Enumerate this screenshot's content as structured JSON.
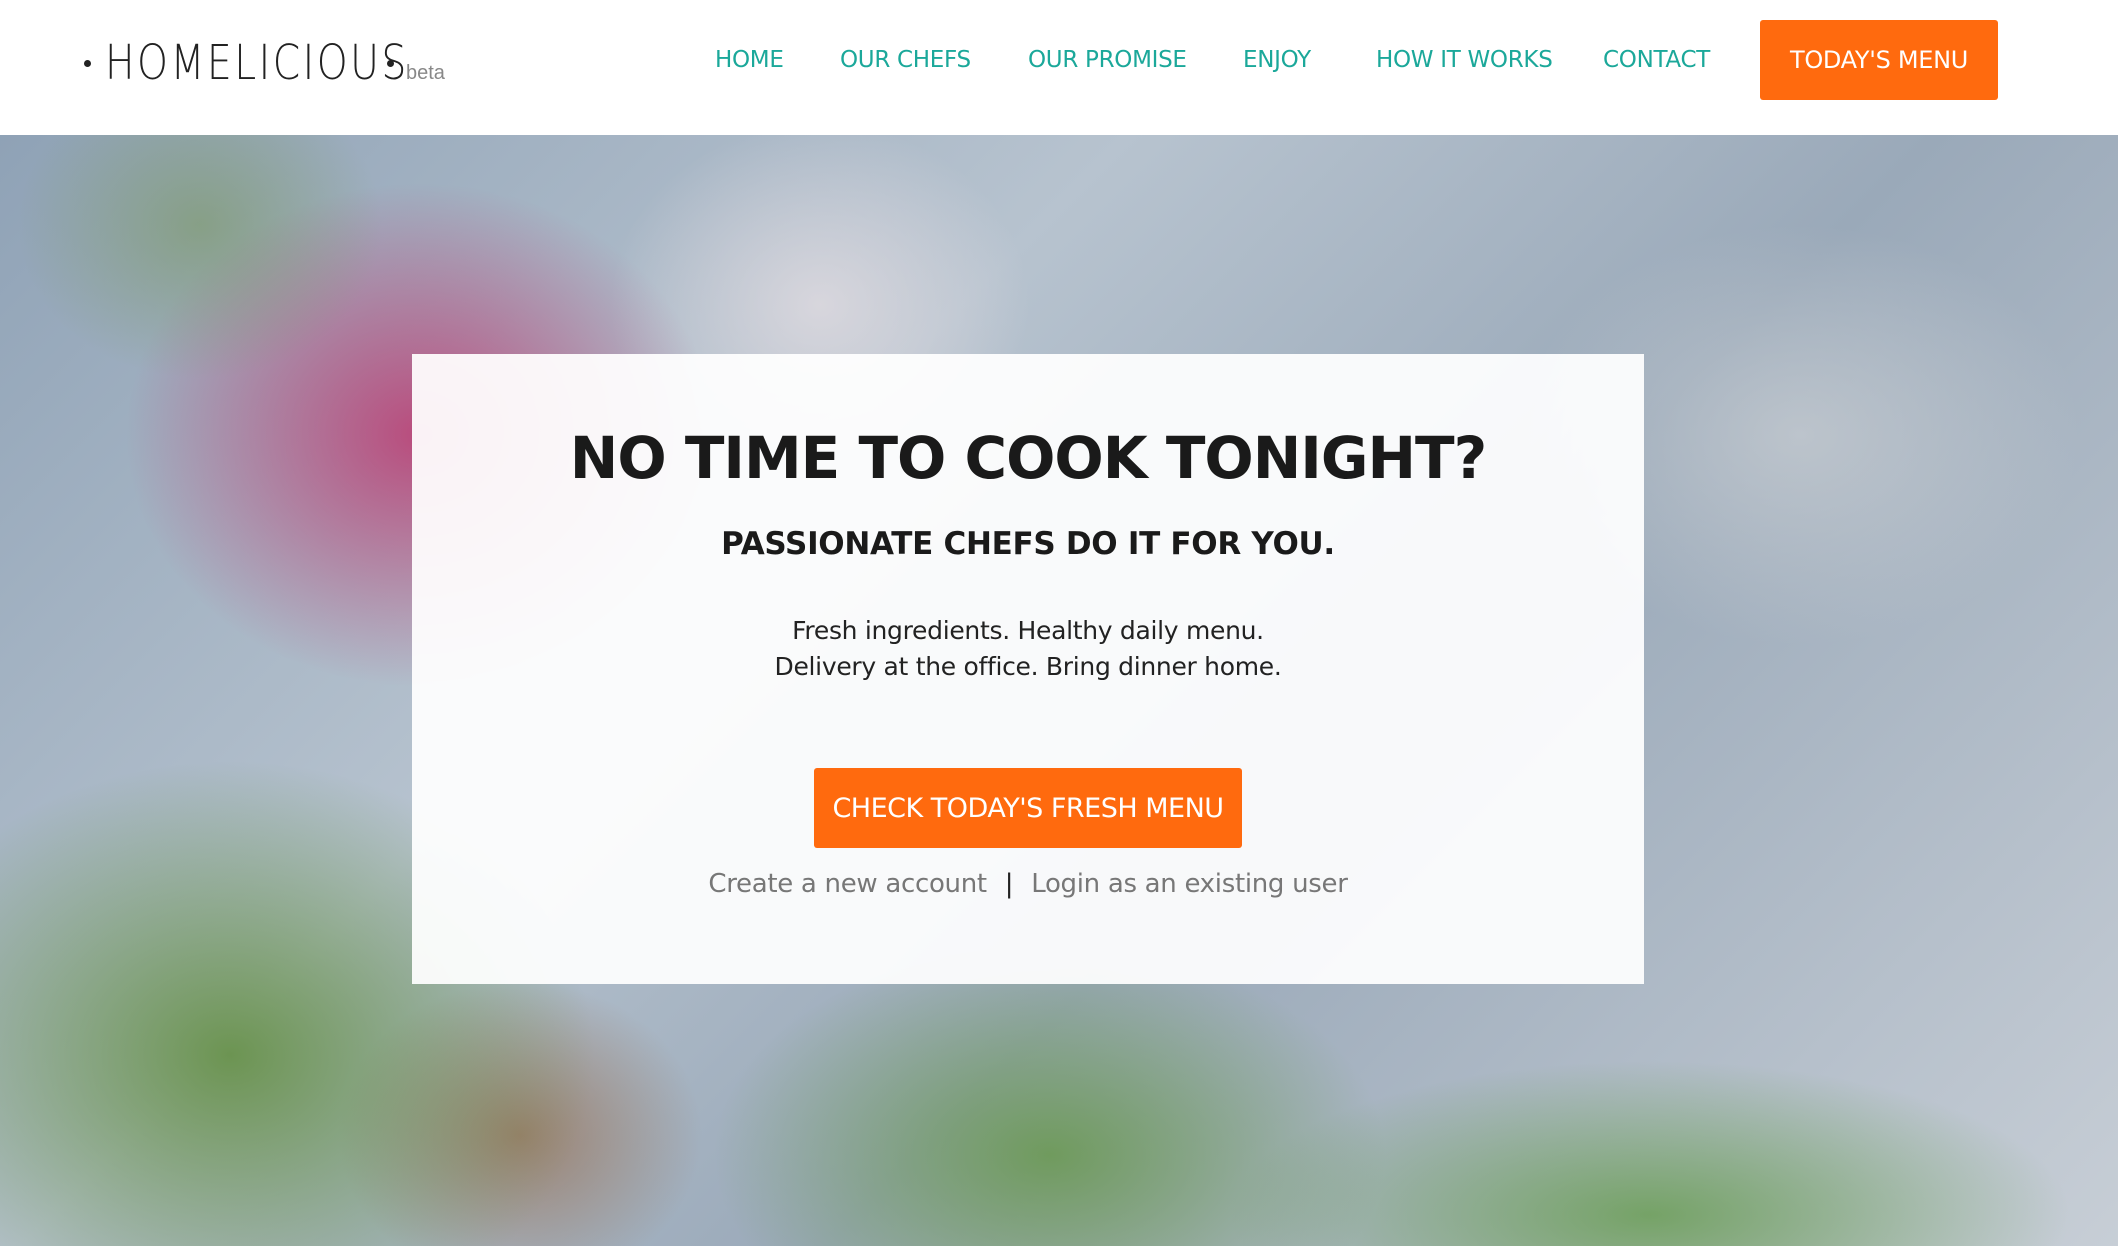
{
  "brand": {
    "name": "HOMELICIOUS",
    "tag": "beta"
  },
  "nav": {
    "items": [
      {
        "label": "HOME"
      },
      {
        "label": "OUR CHEFS"
      },
      {
        "label": "OUR PROMISE"
      },
      {
        "label": "ENJOY"
      },
      {
        "label": "HOW IT WORKS"
      },
      {
        "label": "CONTACT"
      }
    ],
    "cta_label": "TODAY'S MENU"
  },
  "hero": {
    "title": "NO TIME TO COOK TONIGHT?",
    "subtitle": "PASSIONATE CHEFS DO IT FOR YOU.",
    "line1": "Fresh ingredients. Healthy daily menu.",
    "line2": "Delivery at the office. Bring dinner home.",
    "cta_label": "CHECK TODAY'S FRESH MENU",
    "create_account": "Create a new account",
    "separator": "|",
    "login": "Login as an existing user"
  },
  "colors": {
    "accent": "#ff6a0e",
    "nav_link": "#1ba89a",
    "text": "#1a1a1a",
    "muted": "#777777"
  }
}
